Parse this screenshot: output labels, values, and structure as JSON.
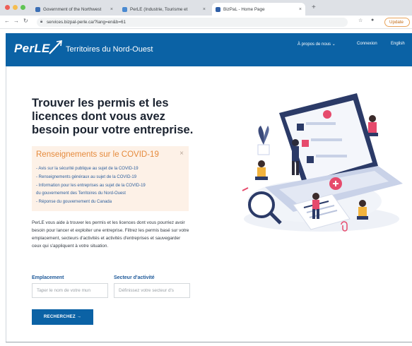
{
  "browser": {
    "tabs": [
      {
        "title": "Government of the Northwest",
        "active": false,
        "favicon_color": "#3c6fb5"
      },
      {
        "title": "PerLE (Industrie, Tourisme et",
        "active": false,
        "favicon_color": "#4a8ad1"
      },
      {
        "title": "BizPaL - Home Page",
        "active": true,
        "favicon_color": "#2f5fa7"
      }
    ],
    "tab_close": "×",
    "new_tab": "+",
    "url": "services.bizpal-perle.ca/?lang=en&b=61",
    "update_label": "Update"
  },
  "site": {
    "logo": "PerLE",
    "title": "Territoires du Nord-Ouest",
    "nav": {
      "about": "À propos de nous",
      "login": "Connexion",
      "language": "English"
    },
    "brand_color": "#0b62a5"
  },
  "hero": {
    "title": "Trouver les permis et les licences dont vous avez besoin pour votre entreprise."
  },
  "covid": {
    "heading": "Renseignements sur le COVID-19",
    "close": "×",
    "items": [
      "- Avis sur la sécurité publique au sujet de la COVID-19",
      "- Renseignements généraux au sujet de la COVID-19",
      "- Information pour les entreprises au sujet de la COVID-19",
      "  du gouvernement des Territoires du Nord-Ouest",
      "- Réponse du gouvernement du Canada"
    ]
  },
  "description": "PerLE vous aide à trouver les permis et les licences dont vous pourriez avoir besoin pour lancer et exploiter une entreprise. Filtrez les permis basé sur votre emplacement, secteurs d'activités et activités d'entreprises et sauvegarder ceux qui s'appliquent à votre situation.",
  "search": {
    "location_label": "Emplacement",
    "location_placeholder": "Taper le nom de votre mun",
    "sector_label": "Secteur d'activité",
    "sector_placeholder": "Définissez votre secteur d's",
    "button_label": "RECHERCHEZ →"
  }
}
